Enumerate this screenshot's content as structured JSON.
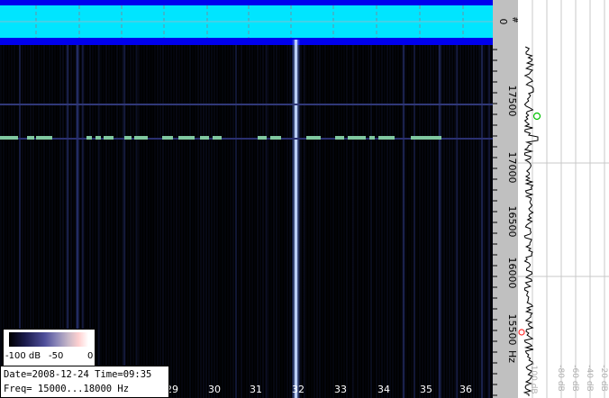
{
  "info": {
    "date_line": "Date=2008-12-24 Time=09:35",
    "freq_line": "Freq= 15000...18000 Hz"
  },
  "colorbar": {
    "label_low": "-100 dB",
    "label_mid": "-50",
    "label_high": "0"
  },
  "time_axis": {
    "labels": [
      "29",
      "30",
      "31",
      "32",
      "33",
      "34",
      "35",
      "36"
    ]
  },
  "freq_axis": {
    "labels": [
      "17500",
      "17000",
      "16500",
      "16000",
      "15500"
    ],
    "unit_label": "Hz",
    "top_label": "0",
    "top_symbol": "#"
  },
  "spectrum_axis": {
    "labels": [
      "-100 dB",
      "-80 dB",
      "-60 dB",
      "-40 dB",
      "-20 dB"
    ]
  },
  "colors": {
    "waterfall_bg": "#000000",
    "header_band": "#00e5ff",
    "header_border": "#0000ee",
    "trace_line": "#80c8a0",
    "scale_bg": "#c0c0c0"
  }
}
